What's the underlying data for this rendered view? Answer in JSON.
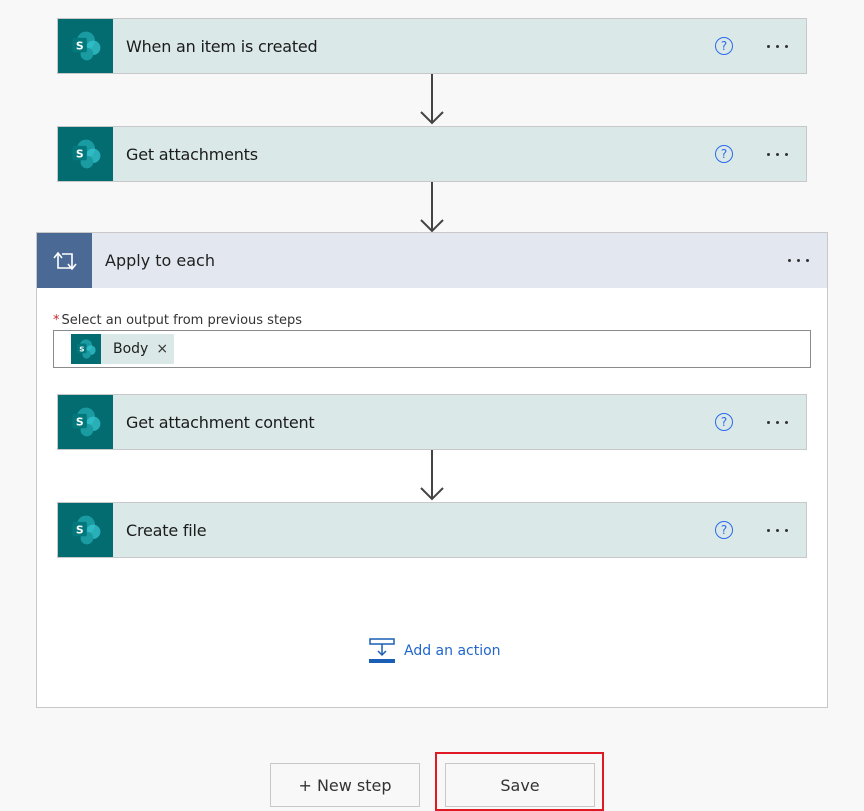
{
  "steps": [
    {
      "title": "When an item is created",
      "icon": "sharepoint-icon"
    },
    {
      "title": "Get attachments",
      "icon": "sharepoint-icon"
    }
  ],
  "loop": {
    "title": "Apply to each",
    "icon": "loop-icon",
    "field_label": "Select an output from previous steps",
    "required_mark": "*",
    "token": {
      "label": "Body",
      "close": "×"
    },
    "inner_steps": [
      {
        "title": "Get attachment content",
        "icon": "sharepoint-icon"
      },
      {
        "title": "Create file",
        "icon": "sharepoint-icon"
      }
    ],
    "add_action_label": "Add an action"
  },
  "help_glyph": "?",
  "footer": {
    "new_step_label": "+ New step",
    "save_label": "Save"
  },
  "colors": {
    "sharepoint": "#036c70",
    "loop": "#4a6a95",
    "card_bg": "#dae8e8",
    "link": "#2266cc",
    "highlight": "#e01a24"
  }
}
